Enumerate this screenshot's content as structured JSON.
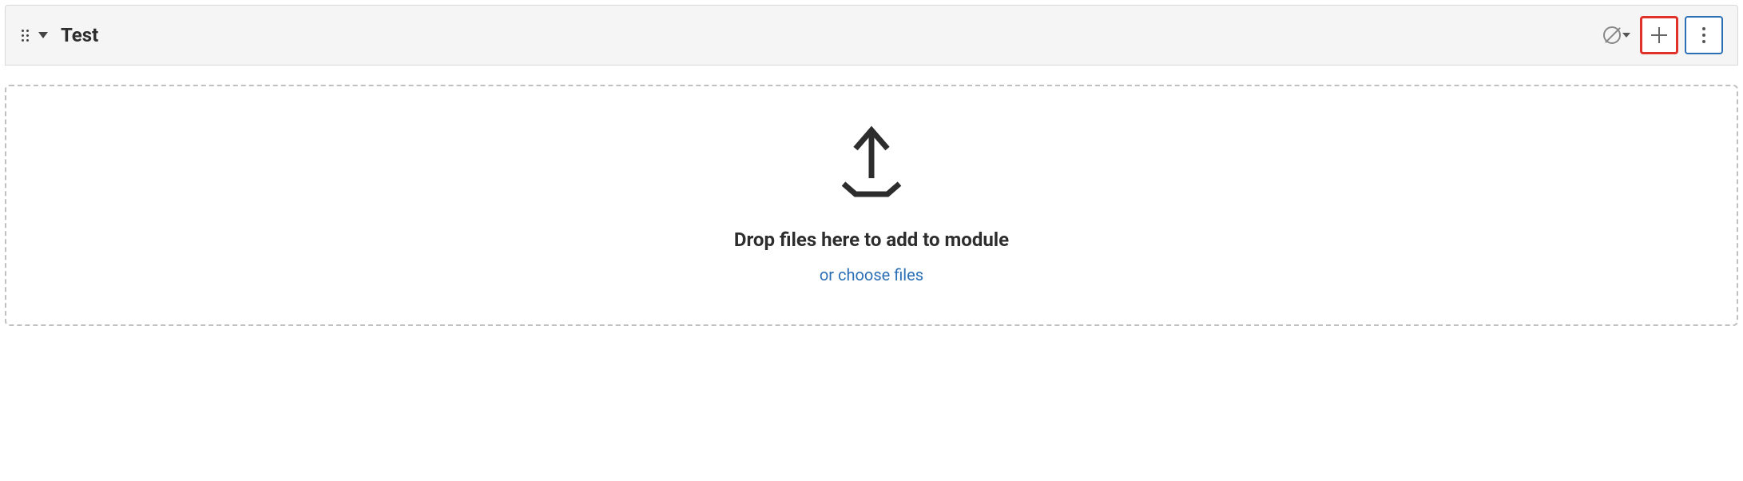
{
  "module": {
    "title": "Test",
    "drop_text": "Drop files here to add to module",
    "choose_files_label": "or choose files"
  },
  "icons": {
    "drag_handle": "drag-handle-icon",
    "collapse": "caret-down-icon",
    "unpublished": "unpublished-icon",
    "publish_caret": "caret-down-icon",
    "add": "plus-icon",
    "more": "kebab-menu-icon",
    "upload": "upload-icon"
  },
  "colors": {
    "highlight_red": "#e0322b",
    "highlight_blue": "#2b6fb5",
    "text_dark": "#2d2d2d",
    "header_bg": "#f5f5f5",
    "border": "#d9d9d9"
  }
}
